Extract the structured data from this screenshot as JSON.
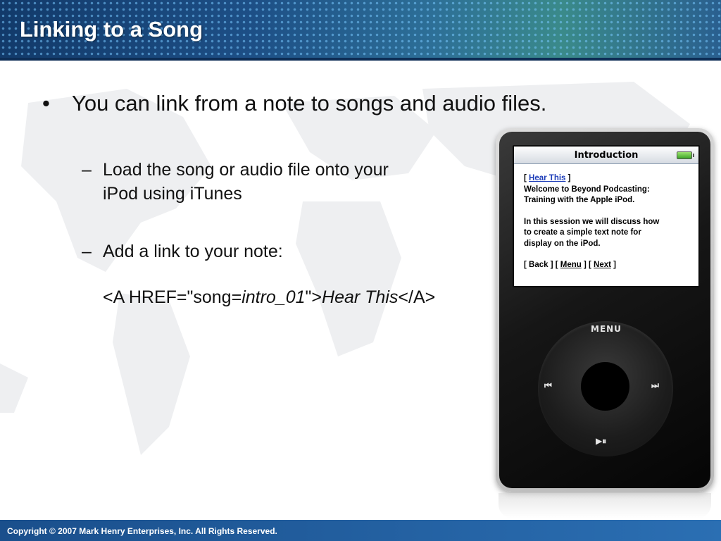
{
  "slide": {
    "title": "Linking to a Song",
    "bullet_symbol": "•",
    "bullet_text": "You can link from a note to songs and audio files.",
    "dash_symbol": "–",
    "sub1_line1": "Load the song or audio file onto your",
    "sub1_line2": "iPod using iTunes",
    "sub2_text": "Add a link to your note:",
    "code": {
      "part1": "<A HREF=\"song=",
      "song_id": "intro_01",
      "part2": "\">",
      "link_text": "Hear This",
      "part3": "</A>"
    }
  },
  "ipod": {
    "screen_title": "Introduction",
    "link_open": "[ ",
    "hear_this": "Hear This",
    "link_close": " ]",
    "welcome_line1": "Welcome to Beyond Podcasting:",
    "welcome_line2": "Training with the Apple iPod.",
    "para2_line1": "In this session we will discuss how",
    "para2_line2": "to create a simple text note for",
    "para2_line3": "display on the iPod.",
    "nav_back": "[ Back ] [ ",
    "nav_menu": "Menu",
    "nav_mid": " ] [ ",
    "nav_next": "Next",
    "nav_end": " ]",
    "wheel_menu": "MENU",
    "wheel_prev": "⏮",
    "wheel_next": "⏭",
    "wheel_play": "▶⏸"
  },
  "footer": {
    "copyright": "Copyright © 2007 Mark Henry Enterprises, Inc. All Rights Reserved."
  },
  "colors": {
    "header_blue": "#1d4f86",
    "footer_blue": "#2b6fb3",
    "link_blue": "#1c3cb8"
  }
}
